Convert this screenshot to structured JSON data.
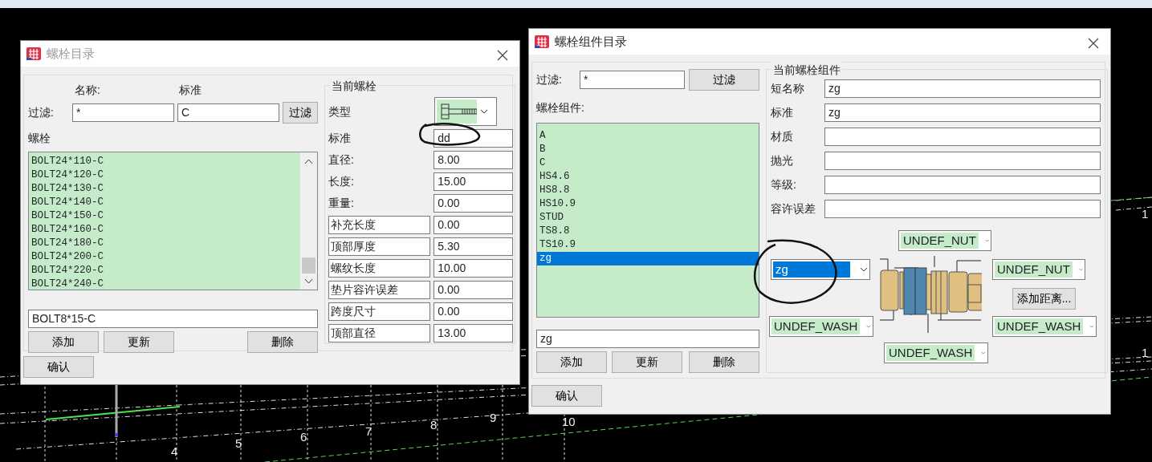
{
  "canvas": {
    "labels": [
      "4",
      "5",
      "6",
      "7",
      "8",
      "9",
      "10",
      "1",
      "1"
    ]
  },
  "bolt_catalog": {
    "title": "螺栓目录",
    "name_label": "名称:",
    "standard_label": "标准",
    "filter_label": "过滤:",
    "filter_name": "*",
    "filter_standard": "C",
    "filter_button": "过滤",
    "list_label": "螺栓",
    "bolts": [
      {
        "label": "BOLT24*110-C",
        "selected": false
      },
      {
        "label": "BOLT24*120-C",
        "selected": false
      },
      {
        "label": "BOLT24*130-C",
        "selected": false
      },
      {
        "label": "BOLT24*140-C",
        "selected": false
      },
      {
        "label": "BOLT24*150-C",
        "selected": false
      },
      {
        "label": "BOLT24*160-C",
        "selected": false
      },
      {
        "label": "BOLT24*180-C",
        "selected": false
      },
      {
        "label": "BOLT24*200-C",
        "selected": false
      },
      {
        "label": "BOLT24*220-C",
        "selected": false
      },
      {
        "label": "BOLT24*240-C",
        "selected": false
      }
    ],
    "name_value": "BOLT8*15-C",
    "buttons": [
      "添加",
      "更新",
      "删除"
    ],
    "current": {
      "title": "当前螺栓",
      "type_label": "类型",
      "fields": [
        {
          "kind": "plain",
          "label": "标准",
          "value": "dd"
        },
        {
          "kind": "plain",
          "label": "直径:",
          "value": "8.00"
        },
        {
          "kind": "plain",
          "label": "长度:",
          "value": "15.00"
        },
        {
          "kind": "plain",
          "label": "重量:",
          "value": "0.00"
        },
        {
          "kind": "boxed",
          "label": "补充长度",
          "value": "0.00"
        },
        {
          "kind": "boxed",
          "label": "顶部厚度",
          "value": "5.30"
        },
        {
          "kind": "boxed",
          "label": "螺纹长度",
          "value": "10.00"
        },
        {
          "kind": "boxed",
          "label": "垫片容许误差",
          "value": "0.00"
        },
        {
          "kind": "boxed",
          "label": "跨度尺寸",
          "value": "0.00"
        },
        {
          "kind": "boxed",
          "label": "顶部直径",
          "value": "13.00"
        }
      ]
    },
    "ok_button": "确认"
  },
  "assembly_catalog": {
    "title": "螺栓组件目录",
    "filter_label": "过滤:",
    "filter_value": "*",
    "filter_button": "过滤",
    "list_label": "螺栓组件:",
    "assemblies": [
      {
        "label": "A",
        "selected": false
      },
      {
        "label": "B",
        "selected": false
      },
      {
        "label": "C",
        "selected": false
      },
      {
        "label": "HS4.6",
        "selected": false
      },
      {
        "label": "HS8.8",
        "selected": false
      },
      {
        "label": "HS10.9",
        "selected": false
      },
      {
        "label": "STUD",
        "selected": false
      },
      {
        "label": "TS8.8",
        "selected": false
      },
      {
        "label": "TS10.9",
        "selected": false
      },
      {
        "label": "zg",
        "selected": true
      }
    ],
    "name_value": "zg",
    "buttons": [
      "添加",
      "更新",
      "删除"
    ],
    "current": {
      "title": "当前螺栓组件",
      "fields": [
        {
          "label": "短名称",
          "value": "zg"
        },
        {
          "label": "标准",
          "value": "zg"
        },
        {
          "label": "材质"
        },
        {
          "label": "抛光"
        },
        {
          "label": "等级:"
        },
        {
          "label": "容许误差"
        }
      ],
      "top_nut": "UNDEF_NUT",
      "bolt": "zg",
      "right_nut": "UNDEF_NUT",
      "add_distance_button": "添加距离...",
      "left_washer": "UNDEF_WASH",
      "right_washer": "UNDEF_WASH",
      "bottom_washer": "UNDEF_WASH"
    },
    "ok_button": "确认"
  }
}
